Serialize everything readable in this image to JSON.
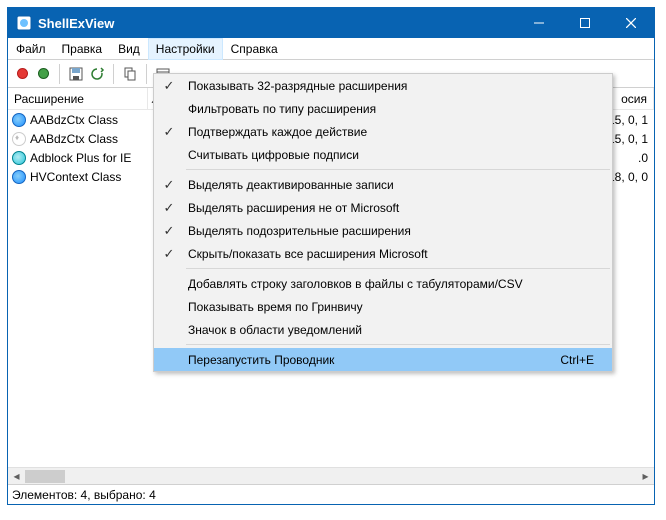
{
  "window": {
    "title": "ShellExView"
  },
  "menubar": {
    "file": "Файл",
    "edit": "Правка",
    "view": "Вид",
    "options": "Настройки",
    "help": "Справка"
  },
  "columns": {
    "name": "Расширение",
    "version": "осия"
  },
  "rows": [
    {
      "name": "AABdzCtx Class",
      "version": "15, 0, 1"
    },
    {
      "name": "AABdzCtx Class",
      "version": "15, 0, 1"
    },
    {
      "name": "Adblock Plus for IE",
      "version": ".0"
    },
    {
      "name": "HVContext Class",
      "version": "18, 0, 0"
    }
  ],
  "menu": {
    "items": [
      {
        "label": "Показывать 32-разрядные расширения",
        "checked": true
      },
      {
        "label": "Фильтровать по типу расширения",
        "checked": false
      },
      {
        "label": "Подтверждать каждое действие",
        "checked": true
      },
      {
        "label": "Считывать цифровые подписи",
        "checked": false
      }
    ],
    "items2": [
      {
        "label": "Выделять деактивированные записи",
        "checked": true
      },
      {
        "label": "Выделять расширения не от Microsoft",
        "checked": true
      },
      {
        "label": "Выделять подозрительные расширения",
        "checked": true
      },
      {
        "label": "Скрыть/показать все расширения Microsoft",
        "checked": true
      }
    ],
    "items3": [
      {
        "label": "Добавлять строку заголовков в файлы с табуляторами/CSV"
      },
      {
        "label": "Показывать время по Гринвичу"
      },
      {
        "label": "Значок в области уведомлений"
      }
    ],
    "restart": {
      "label": "Перезапустить Проводник",
      "accel": "Ctrl+E"
    }
  },
  "statusbar": {
    "text": "Элементов: 4, выбрано: 4"
  }
}
